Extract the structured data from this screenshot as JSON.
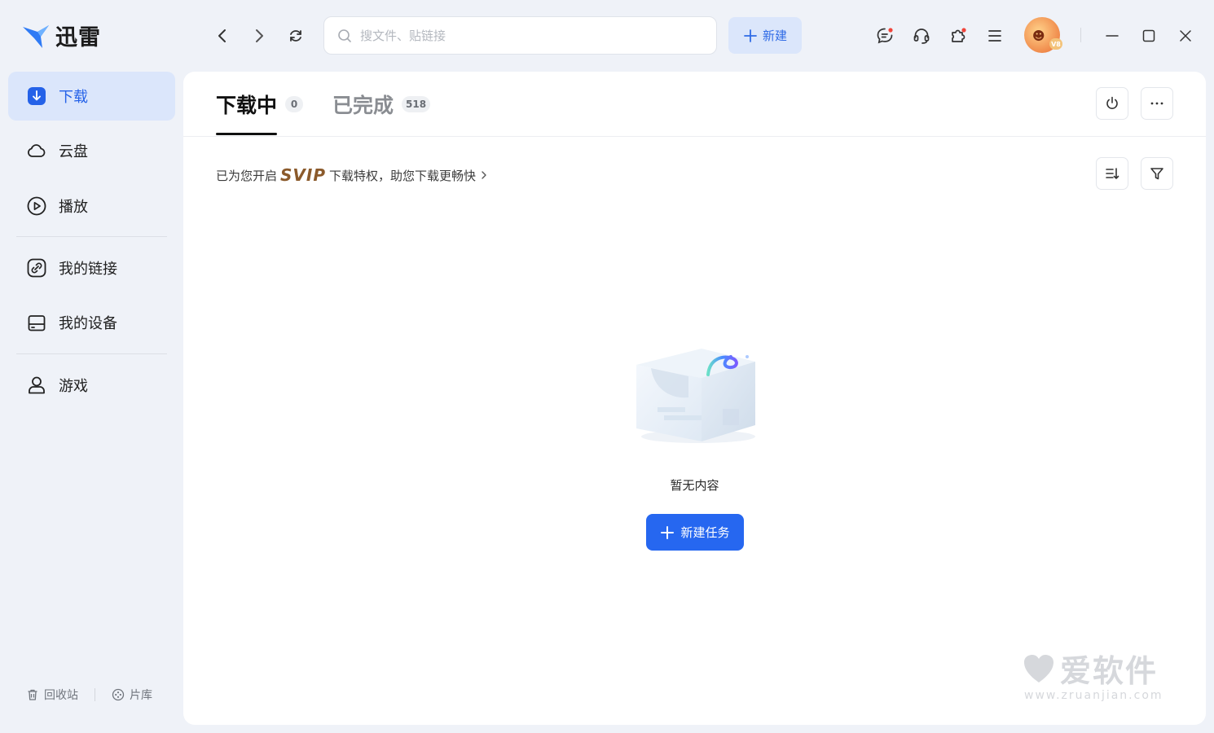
{
  "app": {
    "name": "迅雷"
  },
  "toolbar": {
    "search_placeholder": "搜文件、贴链接",
    "new_label": "新建",
    "vip_badge": "V8"
  },
  "sidebar": {
    "items": [
      {
        "label": "下载",
        "icon": "download-icon",
        "active": true
      },
      {
        "label": "云盘",
        "icon": "cloud-icon"
      },
      {
        "label": "播放",
        "icon": "play-icon"
      },
      {
        "label": "我的链接",
        "icon": "link-icon"
      },
      {
        "label": "我的设备",
        "icon": "device-icon"
      },
      {
        "label": "游戏",
        "icon": "game-icon"
      }
    ],
    "bottom": [
      {
        "label": "回收站",
        "icon": "trash-icon"
      },
      {
        "label": "片库",
        "icon": "film-library-icon"
      }
    ]
  },
  "main": {
    "tabs": [
      {
        "label": "下载中",
        "count": "0",
        "active": true
      },
      {
        "label": "已完成",
        "count": "518",
        "active": false
      }
    ],
    "promo": {
      "prefix": "已为您开启",
      "highlight": "SVIP",
      "suffix": "下载特权，助您下载更畅快"
    },
    "empty_text": "暂无内容",
    "create_task_label": "新建任务"
  },
  "watermark": {
    "title": "爱软件",
    "url": "www.zruanjian.com"
  },
  "colors": {
    "accent": "#2667f0",
    "sidebar_active_bg": "#dbe6fb",
    "svip": "#8b5a2b",
    "background": "#eff2f8"
  }
}
